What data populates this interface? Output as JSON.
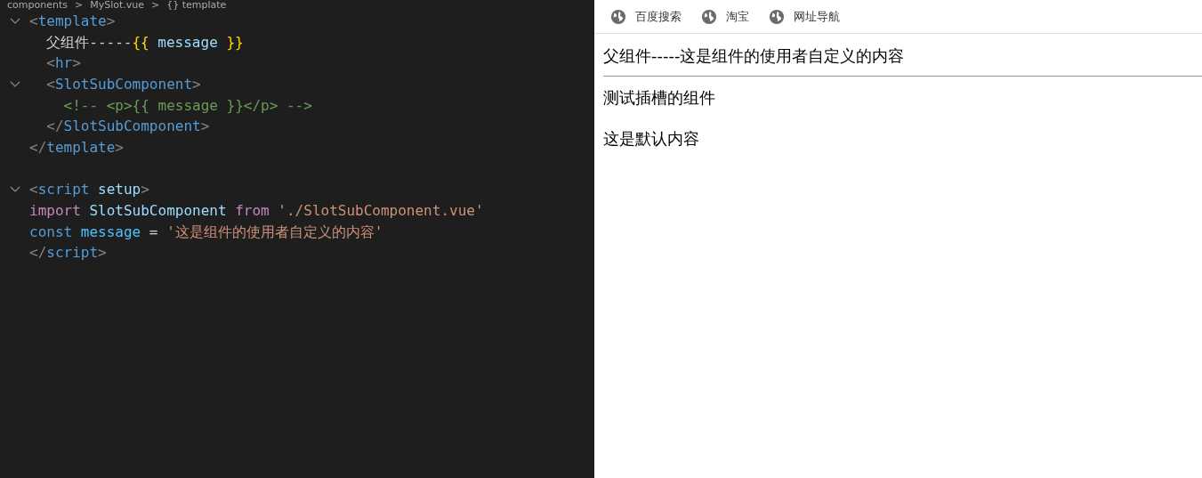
{
  "editor": {
    "breadcrumb": [
      "components",
      ">",
      "MySlot.vue",
      ">",
      "{} template"
    ],
    "lines": [
      {
        "foldable": true,
        "tokens": [
          {
            "text": "<",
            "kind": "punct"
          },
          {
            "text": "template",
            "kind": "tag"
          },
          {
            "text": ">",
            "kind": "punct"
          }
        ]
      },
      {
        "foldable": false,
        "tokens": [
          {
            "text": "  父组件-----",
            "kind": "text"
          },
          {
            "text": "{{",
            "kind": "brace"
          },
          {
            "text": " message ",
            "kind": "var"
          },
          {
            "text": "}}",
            "kind": "brace"
          }
        ]
      },
      {
        "foldable": false,
        "tokens": [
          {
            "text": "  <",
            "kind": "punct"
          },
          {
            "text": "hr",
            "kind": "tag"
          },
          {
            "text": ">",
            "kind": "punct"
          }
        ]
      },
      {
        "foldable": true,
        "tokens": [
          {
            "text": "  <",
            "kind": "punct"
          },
          {
            "text": "SlotSubComponent",
            "kind": "tag"
          },
          {
            "text": ">",
            "kind": "punct"
          }
        ]
      },
      {
        "foldable": false,
        "tokens": [
          {
            "text": "    <!-- <p>{{ message }}</p> -->",
            "kind": "comment"
          }
        ]
      },
      {
        "foldable": false,
        "tokens": [
          {
            "text": "  </",
            "kind": "punct"
          },
          {
            "text": "SlotSubComponent",
            "kind": "tag"
          },
          {
            "text": ">",
            "kind": "punct"
          }
        ]
      },
      {
        "foldable": false,
        "tokens": [
          {
            "text": "</",
            "kind": "punct"
          },
          {
            "text": "template",
            "kind": "tag"
          },
          {
            "text": ">",
            "kind": "punct"
          }
        ]
      },
      {
        "foldable": false
      },
      {
        "foldable": true,
        "tokens": [
          {
            "text": "<",
            "kind": "punct"
          },
          {
            "text": "script",
            "kind": "tag"
          },
          {
            "text": " setup",
            "kind": "attr"
          },
          {
            "text": ">",
            "kind": "punct"
          }
        ]
      },
      {
        "foldable": false,
        "tokens": [
          {
            "text": "import",
            "kind": "keyword"
          },
          {
            "text": " SlotSubComponent ",
            "kind": "var"
          },
          {
            "text": "from",
            "kind": "keyword"
          },
          {
            "text": " './SlotSubComponent.vue'",
            "kind": "string"
          }
        ]
      },
      {
        "foldable": false,
        "tokens": [
          {
            "text": "const",
            "kind": "tag"
          },
          {
            "text": " message",
            "kind": "const"
          },
          {
            "text": " = ",
            "kind": "text"
          },
          {
            "text": "'这是组件的使用者自定义的内容'",
            "kind": "string"
          }
        ]
      },
      {
        "foldable": false,
        "tokens": [
          {
            "text": "</",
            "kind": "punct"
          },
          {
            "text": "script",
            "kind": "tag"
          },
          {
            "text": ">",
            "kind": "punct"
          }
        ]
      }
    ]
  },
  "browser": {
    "bookmarks": [
      "百度搜索",
      "淘宝",
      "网址导航"
    ],
    "content": [
      {
        "kind": "text",
        "text": "父组件-----这是组件的使用者自定义的内容"
      },
      {
        "kind": "rule"
      },
      {
        "kind": "text",
        "text": "测试插槽的组件"
      },
      {
        "kind": "text",
        "text": "这是默认内容"
      }
    ]
  }
}
